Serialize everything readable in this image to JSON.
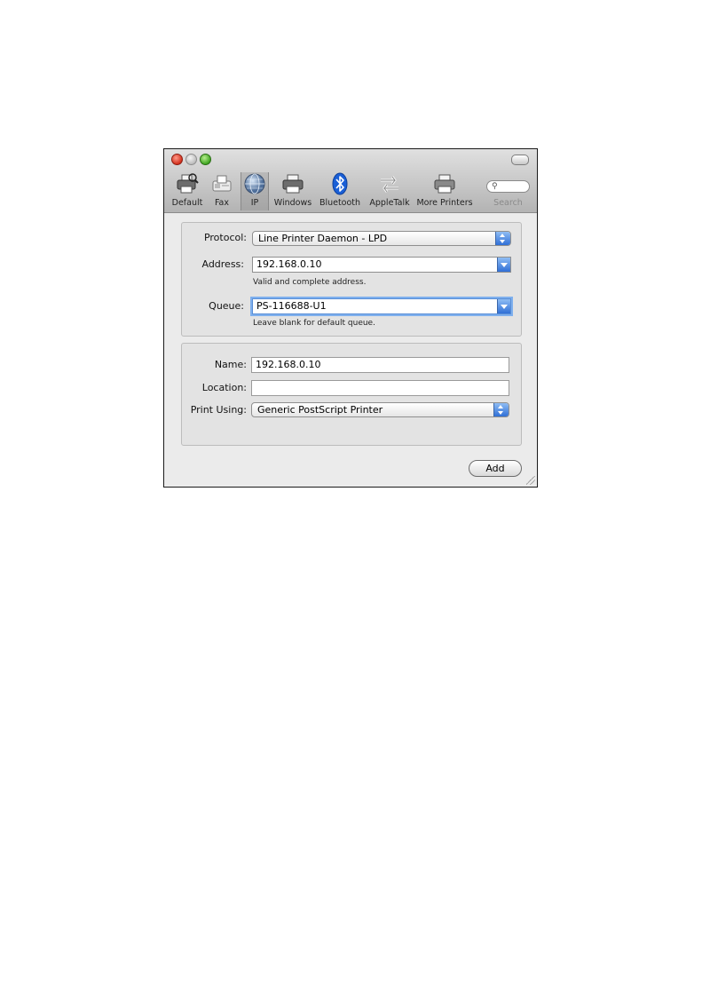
{
  "toolbar": {
    "items": [
      {
        "label": "Default",
        "icon": "printer-search-icon"
      },
      {
        "label": "Fax",
        "icon": "fax-icon"
      },
      {
        "label": "IP",
        "icon": "globe-icon",
        "selected": true
      },
      {
        "label": "Windows",
        "icon": "printer-icon"
      },
      {
        "label": "Bluetooth",
        "icon": "bluetooth-icon"
      },
      {
        "label": "AppleTalk",
        "icon": "arrows-icon"
      },
      {
        "label": "More Printers",
        "icon": "printer-icon"
      }
    ],
    "search_label": "Search",
    "search_icon": "magnifier-icon"
  },
  "connection": {
    "protocol_label": "Protocol:",
    "protocol_value": "Line Printer Daemon - LPD",
    "address_label": "Address:",
    "address_value": "192.168.0.10",
    "address_hint": "Valid and complete address.",
    "queue_label": "Queue:",
    "queue_value": "PS-116688-U1",
    "queue_hint": "Leave blank for default queue."
  },
  "printer": {
    "name_label": "Name:",
    "name_value": "192.168.0.10",
    "location_label": "Location:",
    "location_value": "",
    "print_using_label": "Print Using:",
    "print_using_value": "Generic PostScript Printer"
  },
  "add_button": "Add",
  "colors": {
    "accent": "#2f6fd6",
    "bluetooth": "#1a5fd6"
  }
}
